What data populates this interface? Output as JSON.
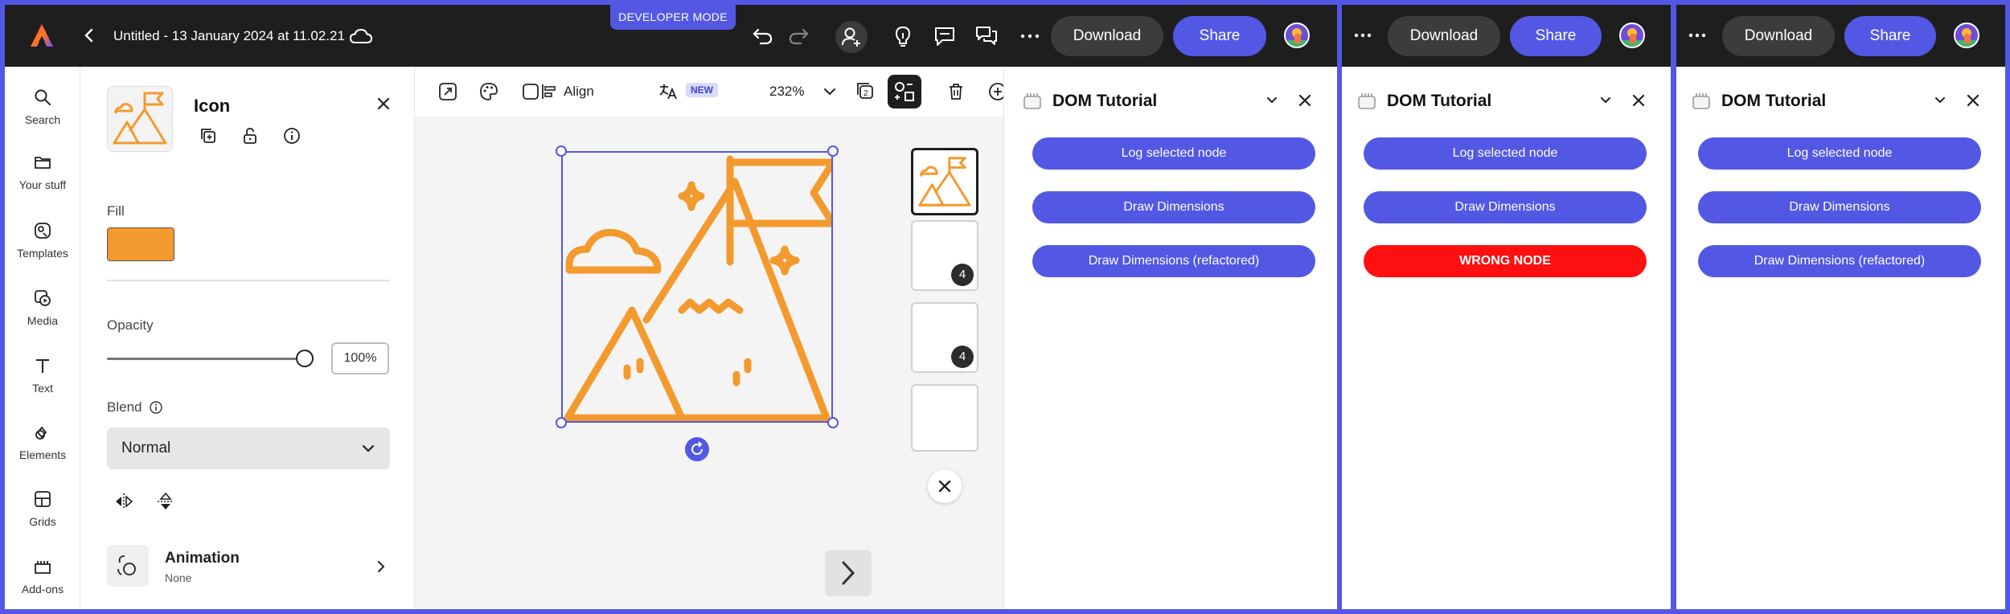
{
  "editor": {
    "doc_title": "Untitled - 13 January 2024 at 11.02.21",
    "dev_mode_badge": "DEVELOPER MODE",
    "download_label": "Download",
    "share_label": "Share"
  },
  "rail": {
    "items": [
      {
        "label": "Search",
        "icon": "search-icon"
      },
      {
        "label": "Your stuff",
        "icon": "folder-icon"
      },
      {
        "label": "Templates",
        "icon": "templates-icon"
      },
      {
        "label": "Media",
        "icon": "media-icon"
      },
      {
        "label": "Text",
        "icon": "text-icon"
      },
      {
        "label": "Elements",
        "icon": "elements-icon"
      },
      {
        "label": "Grids",
        "icon": "grids-icon"
      },
      {
        "label": "Add-ons",
        "icon": "add-ons-icon"
      }
    ]
  },
  "props": {
    "title": "Icon",
    "fill_label": "Fill",
    "fill_color": "#f39a2e",
    "opacity_label": "Opacity",
    "opacity_value": "100%",
    "blend_label": "Blend",
    "blend_value": "Normal",
    "animation_title": "Animation",
    "animation_value": "None"
  },
  "toolbar": {
    "align_label": "Align",
    "new_badge": "NEW",
    "zoom": "232%"
  },
  "pages": {
    "badge_1": "4",
    "badge_2": "4"
  },
  "panels": [
    {
      "download_label": "Download",
      "share_label": "Share",
      "title": "DOM Tutorial",
      "buttons": [
        "Log selected node",
        "Draw Dimensions",
        "WRONG NODE"
      ]
    },
    {
      "download_label": "Download",
      "share_label": "Share",
      "title": "DOM Tutorial",
      "buttons": [
        "Log selected node",
        "Draw Dimensions",
        "Draw Dimensions (refactored)"
      ]
    }
  ],
  "main_panel": {
    "title": "DOM Tutorial",
    "buttons": [
      "Log selected node",
      "Draw Dimensions",
      "Draw Dimensions (refactored)"
    ]
  },
  "colors": {
    "accent": "#5258e4",
    "icon_orange": "#f39a2e",
    "error_red": "#ff1010",
    "topbar": "#1e1e1e"
  }
}
